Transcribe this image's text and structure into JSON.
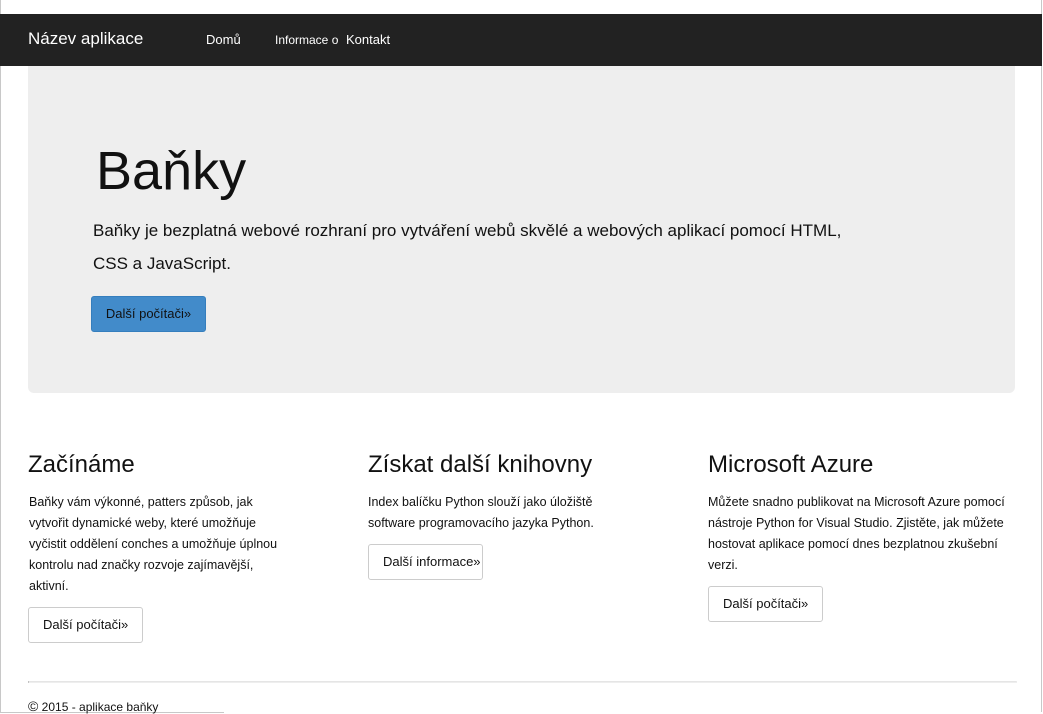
{
  "navbar": {
    "brand": "Název aplikace",
    "links": [
      {
        "label": "Domů"
      },
      {
        "label": "Informace o"
      },
      {
        "label": "Kontakt"
      }
    ]
  },
  "hero": {
    "title": "Baňky",
    "lead": "Baňky je bezplatná webové rozhraní pro vytváření webů skvělé a webových aplikací pomocí HTML, CSS a JavaScript.",
    "button": "Další počítači»"
  },
  "columns": [
    {
      "heading": "Začínáme",
      "text": "Baňky vám výkonné, patters způsob, jak vytvořit dynamické weby, které umožňuje vyčistit oddělení conches a umožňuje úplnou kontrolu nad značky rozvoje zajímavější, aktivní.",
      "button": "Další počítači»"
    },
    {
      "heading": "Získat další knihovny",
      "text": "Index balíčku Python slouží jako úložiště software programovacího jazyka Python.",
      "button": "Další informace»"
    },
    {
      "heading": "Microsoft Azure",
      "text": "Můžete snadno publikovat na Microsoft Azure pomocí nástroje Python for Visual Studio. Zjistěte, jak můžete hostovat aplikace pomocí dnes bezplatnou zkušební verzi.",
      "button": "Další počítači»"
    }
  ],
  "footer": {
    "copyright_symbol": "©",
    "text": "2015 - aplikace baňky"
  },
  "colors": {
    "navbar_bg": "#222222",
    "jumbotron_bg": "#eeeeee",
    "primary_button": "#428bca"
  }
}
